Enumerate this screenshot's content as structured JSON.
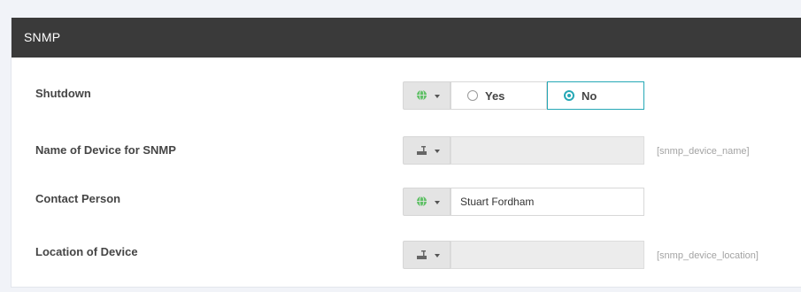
{
  "panel": {
    "title": "SNMP"
  },
  "colors": {
    "header_bg": "#3a3a3a",
    "accent": "#26a8b6",
    "globe_icon": "#5fc066",
    "disabled_field": "#ececec",
    "hint_text": "#a3a3a3"
  },
  "rows": {
    "shutdown": {
      "label": "Shutdown",
      "scope_icon": "globe-icon",
      "options": [
        "Yes",
        "No"
      ],
      "selected": "No"
    },
    "device_name": {
      "label": "Name of Device for SNMP",
      "scope_icon": "device-icon",
      "value": "",
      "hint": "[snmp_device_name]",
      "disabled": true
    },
    "contact": {
      "label": "Contact Person",
      "scope_icon": "globe-icon",
      "value": "Stuart Fordham"
    },
    "location": {
      "label": "Location of Device",
      "scope_icon": "device-icon",
      "value": "",
      "hint": "[snmp_device_location]",
      "disabled": true
    }
  }
}
